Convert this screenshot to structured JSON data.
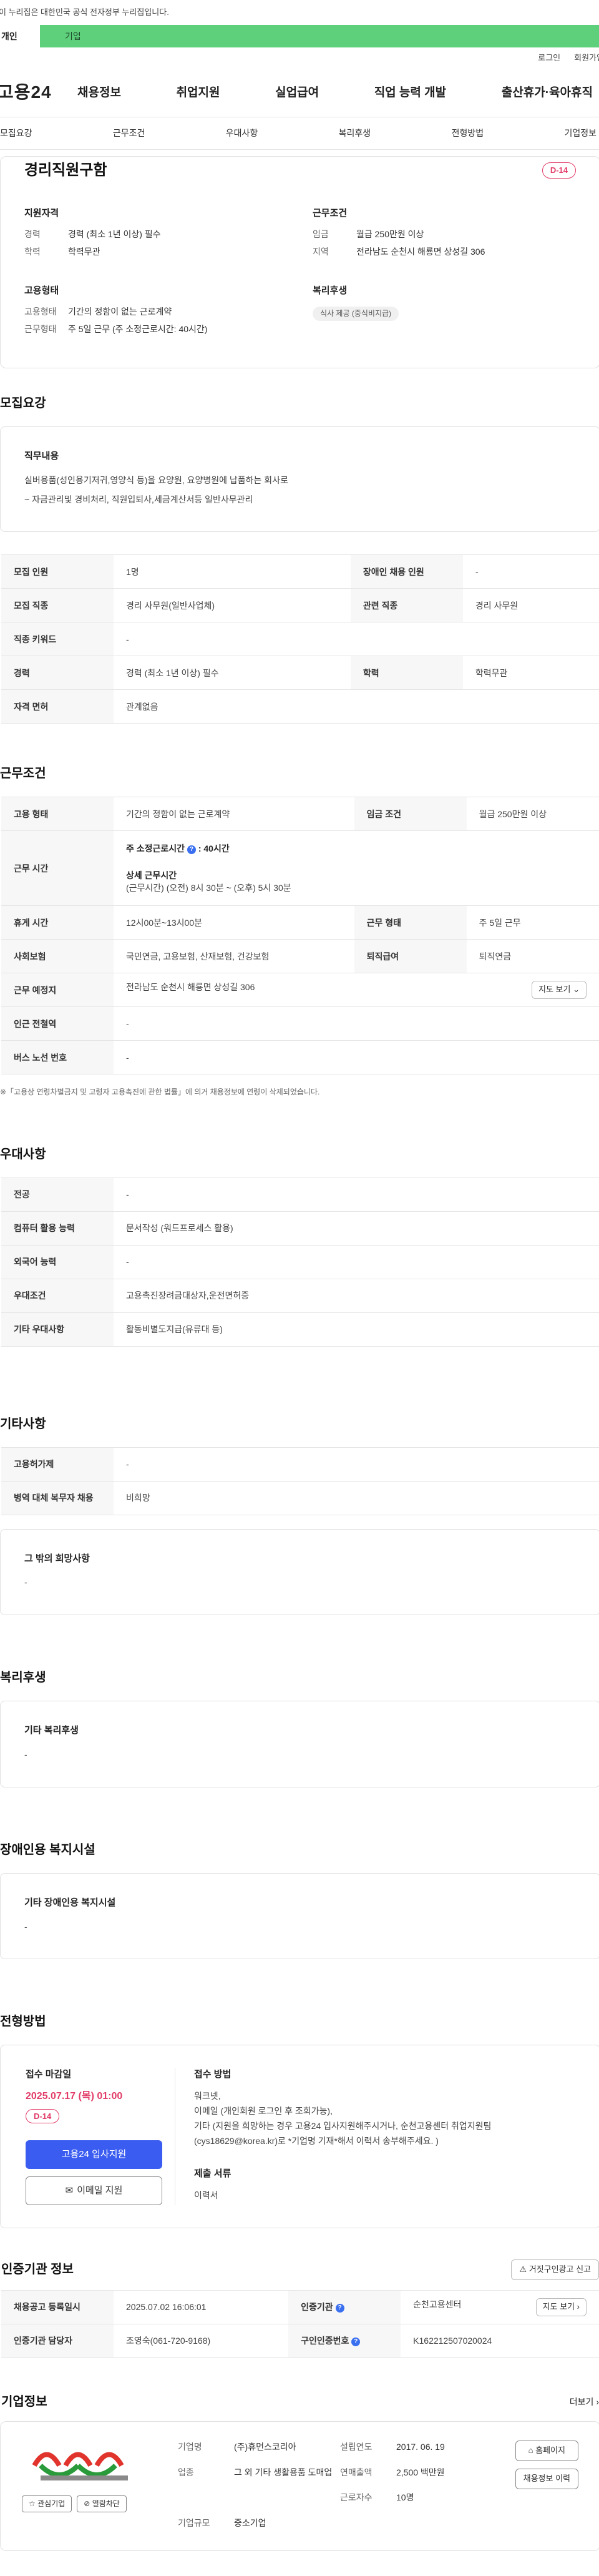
{
  "gov_banner": "이 누리집은 대한민국 공식 전자정부 누리집입니다.",
  "tabs": {
    "personal": "개인",
    "company": "기업"
  },
  "util": {
    "login": "로그인",
    "join": "회원가입"
  },
  "logo": "고용24",
  "gnb": [
    "채용정보",
    "취업지원",
    "실업급여",
    "직업 능력 개발",
    "출산휴가·육아휴직"
  ],
  "anchors": [
    "모집요강",
    "근무조건",
    "우대사항",
    "복리후생",
    "전형방법",
    "기업정보"
  ],
  "summary": {
    "title": "경리직원구함",
    "dday": "D-14",
    "qual_title": "지원자격",
    "career_k": "경력",
    "career_v": "경력 (최소 1년 이상) 필수",
    "edu_k": "학력",
    "edu_v": "학력무관",
    "emp_title": "고용형태",
    "emptype_k": "고용형태",
    "emptype_v": "기간의 정함이 없는 근로계약",
    "work_k": "근무형태",
    "work_v": "주 5일 근무 (주 소정근로시간: 40시간)",
    "cond_title": "근무조건",
    "wage_k": "임금",
    "wage_v": "월급 250만원 이상",
    "area_k": "지역",
    "area_v": "전라남도 순천시 해룡면 상성길 306",
    "welfare_title": "복리후생",
    "welfare_chip": "식사 제공 (중식비지급)"
  },
  "recruit": {
    "title": "모집요강",
    "duty_title": "직무내용",
    "duty_line1": "실버용품(성인용기저귀,영양식 등)을 요양원, 요양병원에 납품하는 회사로",
    "duty_line2": "~ 자금관리및 경비처리, 직원입퇴사,세금계산서등 일반사무관리",
    "rows": [
      [
        "모집 인원",
        "1명",
        "장애인 채용 인원",
        "-"
      ],
      [
        "모집 직종",
        "경리 사무원(일반사업체)",
        "관련 직종",
        "경리 사무원"
      ],
      [
        "직종 키워드",
        "-",
        "",
        ""
      ],
      [
        "경력",
        "경력 (최소 1년 이상) 필수",
        "학력",
        "학력무관"
      ],
      [
        "자격 면허",
        "관계없음",
        "",
        ""
      ]
    ]
  },
  "work": {
    "title": "근무조건",
    "type_k": "고용 형태",
    "type_v": "기간의 정함이 없는 근로계약",
    "wage_k": "임금 조건",
    "wage_v": "월급 250만원 이상",
    "hours_k": "근무 시간",
    "weekly": "주 소정근로시간",
    "weekly_v": ": 40시간",
    "detail_title": "상세 근무시간",
    "detail_v": "(근무시간) (오전) 8시 30분 ~ (오후) 5시 30분",
    "rest_k": "휴게 시간",
    "rest_v": "12시00분~13시00분",
    "form_k": "근무 형태",
    "form_v": "주 5일 근무",
    "ins_k": "사회보험",
    "ins_v": "국민연금, 고용보험, 산재보험, 건강보험",
    "ret_k": "퇴직급여",
    "ret_v": "퇴직연금",
    "place_k": "근무 예정지",
    "place_v": "전라남도 순천시 해룡면 상성길 306",
    "map_btn": "지도 보기",
    "subway_k": "인근 전철역",
    "subway_v": "-",
    "bus_k": "버스 노선 번호",
    "bus_v": "-",
    "note": "※「고용상 연령차별금지 및 고령자 고용촉진에 관한 법률」에 의거 채용정보에 연령이 삭제되었습니다."
  },
  "pref": {
    "title": "우대사항",
    "rows": [
      [
        "전공",
        "-"
      ],
      [
        "컴퓨터 활용 능력",
        "문서작성 (워드프로세스 활용)"
      ],
      [
        "외국어 능력",
        "-"
      ],
      [
        "우대조건",
        "고용촉진장려금대상자,운전면허증"
      ],
      [
        "기타 우대사항",
        "활동비별도지급(유류대 등)"
      ]
    ]
  },
  "etc": {
    "title": "기타사항",
    "rows": [
      [
        "고용허가제",
        "-"
      ],
      [
        "병역 대체 복무자 채용",
        "비희망"
      ]
    ],
    "hope_title": "그 밖의 희망사항",
    "hope_v": "-"
  },
  "welfare": {
    "title": "복리후생",
    "box_title": "기타 복리후생",
    "box_v": "-"
  },
  "disabled": {
    "title": "장애인용 복지시설",
    "box_title": "기타 장애인용 복지시설",
    "box_v": "-"
  },
  "selection": {
    "title": "전형방법",
    "deadline_label": "접수 마감일",
    "deadline": "2025.07.17 (목) 01:00",
    "dday": "D-14",
    "apply_btn": "고용24 입사지원",
    "email_btn": "이메일 지원",
    "method_label": "접수 방법",
    "method_1": "워크넷,",
    "method_2": "이메일 (개인회원 로그인 후 조회가능),",
    "method_3": "기타 (지원을 희망하는 경우 고용24 입사지원해주시거나, 순천고용센터 취업지원팀(cys18629@korea.kr)로 *기업명 기재*해서 이력서 송부해주세요. )",
    "docs_label": "제출 서류",
    "docs_v": "이력서"
  },
  "cert": {
    "title": "인증기관 정보",
    "report_btn": "거짓구인광고 신고",
    "reg_k": "채용공고 등록일시",
    "reg_v": "2025.07.02 16:06:01",
    "org_k": "인증기관",
    "org_v": "순천고용센터",
    "map_btn": "지도 보기",
    "mgr_k": "인증기관 담당자",
    "mgr_v": "조영숙(061-720-9168)",
    "num_k": "구인인증번호",
    "num_v": "K162212507020024"
  },
  "company": {
    "title": "기업정보",
    "more": "더보기",
    "fav_btn": "관심기업",
    "block_btn": "열람차단",
    "name_k": "기업명",
    "name_v": "(주)휴먼스코리아",
    "year_k": "설립연도",
    "year_v": "2017. 06. 19",
    "biz_k": "업종",
    "biz_v": "그 외 기타 생활용품 도매업",
    "rev_k": "연매출액",
    "rev_v": "2,500 백만원",
    "emp_k": "근로자수",
    "emp_v": "10명",
    "size_k": "기업규모",
    "size_v": "중소기업",
    "home_btn": "홈페이지",
    "history_btn": "채용정보 이력"
  }
}
